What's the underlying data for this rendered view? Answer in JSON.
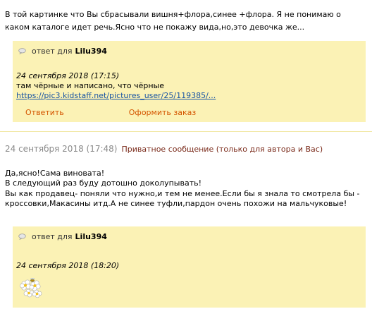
{
  "top_post": {
    "text": "В той картинке что Вы сбрасывали вишня+флора,синее +флора. Я не понимаю о каком каталоге идет речь.Ясно что не покажу вида,но,это девочка же..."
  },
  "quote1": {
    "reply_to_label": "ответ для",
    "author": "Lilu394",
    "date": "24 сентября 2018 (17:15)",
    "text": "там чёрные и написано, что чёрные",
    "link": "https://pic3.kidstaff.net/pictures_user/25/119385/..."
  },
  "actions": {
    "reply": "Ответить",
    "order": "Оформить заказ"
  },
  "post2": {
    "date": "24 сентября 2018 (17:48)",
    "private_label": "Приватное сообщение (только для автора и Вас)",
    "text": "Да,ясно!Сама виновата!\nВ следующий раз буду дотошно доколупывать!\nВы как продавец- поняли что нужно,и тем не менее.Если бы я знала то смотрела бы - кроссовки,Макасины итд.А не синее туфли,пардон очень похожи на мальчуковые!"
  },
  "quote2": {
    "reply_to_label": "ответ для",
    "author": "Lilu394",
    "date": "24 сентября 2018 (18:20)"
  },
  "icons": {
    "bubble": "speech-bubble-icon",
    "flower": "flower-bee-sticker"
  },
  "colors": {
    "quote_bg": "#fbf2b5",
    "action": "#d45500",
    "link": "#1a55a3",
    "private": "#7a2a1a"
  }
}
